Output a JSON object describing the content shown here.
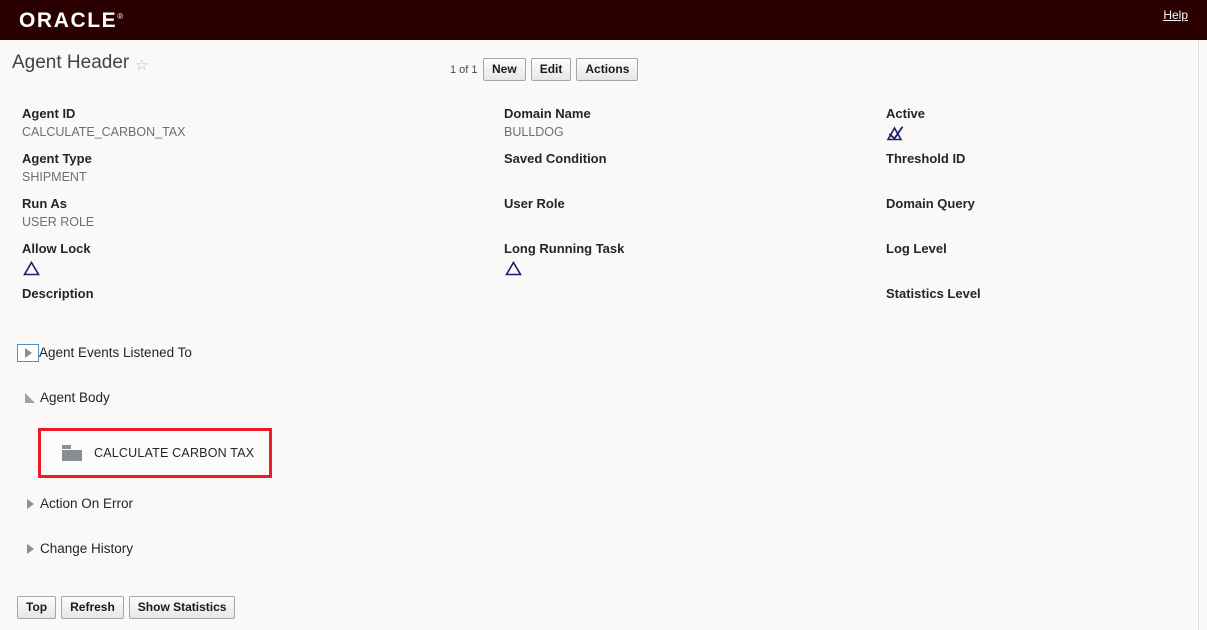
{
  "brand": {
    "logo_text": "ORACLE",
    "help_label": "Help",
    "bar_color": "#2b0000"
  },
  "page": {
    "title": "Agent Header",
    "favorite_icon": "star-outline-icon",
    "record_count": "1 of 1"
  },
  "toolbar": {
    "buttons": [
      {
        "label": "New"
      },
      {
        "label": "Edit"
      },
      {
        "label": "Actions"
      }
    ]
  },
  "fields": {
    "column_1": [
      {
        "label": "Agent ID",
        "value": "CALCULATE_CARBON_TAX",
        "type": "text"
      },
      {
        "label": "Agent Type",
        "value": "SHIPMENT",
        "type": "text"
      },
      {
        "label": "Run As",
        "value": "USER ROLE",
        "type": "text"
      },
      {
        "label": "Allow Lock",
        "value": "",
        "type": "checkbox",
        "checked": false
      },
      {
        "label": "Description",
        "value": "",
        "type": "text"
      }
    ],
    "column_2": [
      {
        "label": "Domain Name",
        "value": "BULLDOG",
        "type": "text"
      },
      {
        "label": "Saved Condition",
        "value": "",
        "type": "text"
      },
      {
        "label": "User Role",
        "value": "",
        "type": "text"
      },
      {
        "label": "Long Running Task",
        "value": "",
        "type": "checkbox",
        "checked": false
      }
    ],
    "column_3": [
      {
        "label": "Active",
        "value": "",
        "type": "checkbox",
        "checked": true
      },
      {
        "label": "Threshold ID",
        "value": "",
        "type": "text"
      },
      {
        "label": "Domain Query",
        "value": "",
        "type": "text"
      },
      {
        "label": "Log Level",
        "value": "",
        "type": "text"
      },
      {
        "label": "Statistics Level",
        "value": "",
        "type": "text"
      }
    ]
  },
  "sections": [
    {
      "label": "Agent Events Listened To",
      "expanded": false,
      "focused": true
    },
    {
      "label": "Agent Body",
      "expanded": true,
      "focused": false
    },
    {
      "label": "Action On Error",
      "expanded": false,
      "focused": false
    },
    {
      "label": "Change History",
      "expanded": false,
      "focused": false
    }
  ],
  "agent_body": {
    "node_label": "CALCULATE CARBON TAX",
    "node_icon": "folder-icon",
    "highlight_color": "#ed1c24"
  },
  "footer": {
    "buttons": [
      {
        "label": "Top"
      },
      {
        "label": "Refresh"
      },
      {
        "label": "Show Statistics"
      }
    ]
  },
  "colors": {
    "brand_bar": "#2b0000",
    "page_background": "#faf9f8",
    "label_text": "#22262c",
    "value_text": "#6b6f76",
    "annotation_red": "#ed1c24",
    "checkbox_navy": "#1c1c6e"
  }
}
